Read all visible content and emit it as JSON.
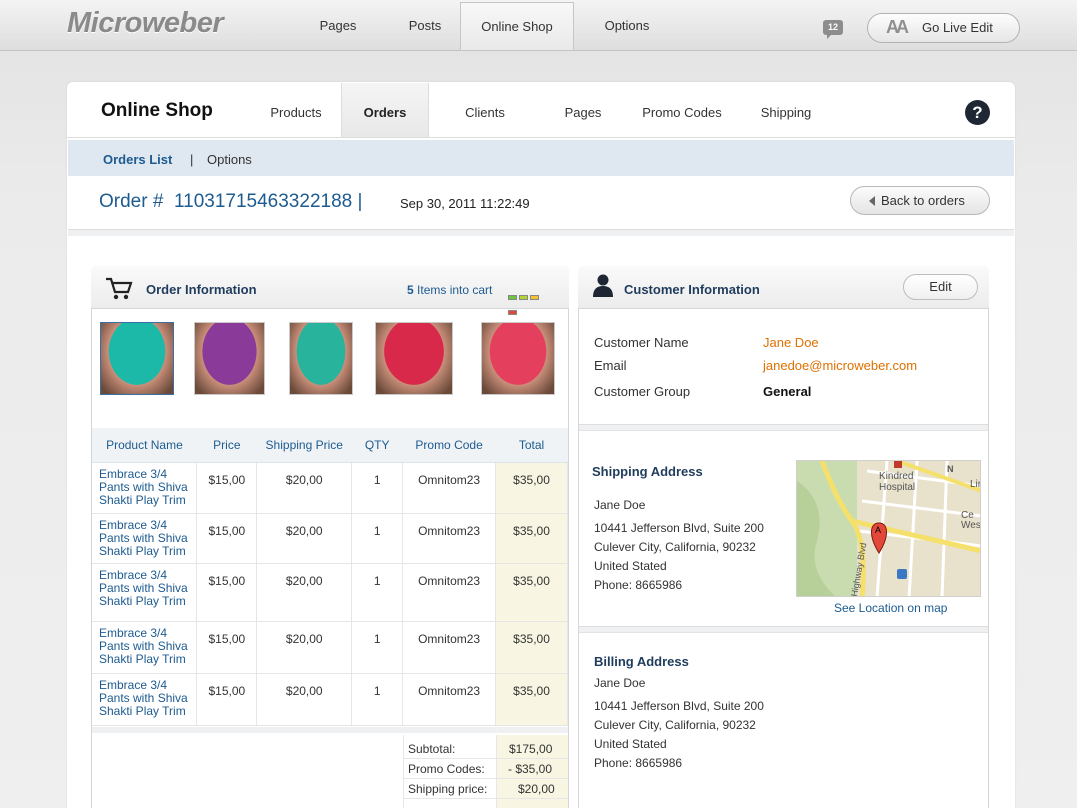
{
  "topbar": {
    "logo": "Microweber",
    "nav": [
      "Pages",
      "Posts",
      "Online Shop",
      "Options"
    ],
    "active_nav": "Online Shop",
    "notifications": "12",
    "golive_label": "Go Live Edit"
  },
  "shop": {
    "title": "Online Shop",
    "tabs": [
      "Products",
      "Orders",
      "Clients",
      "Pages",
      "Promo Codes",
      "Shipping"
    ],
    "active_tab": "Orders",
    "help": "?",
    "subtabs": {
      "orders_list": "Orders List",
      "separator": "|",
      "options": "Options"
    }
  },
  "order": {
    "number_label": "Order #",
    "number": "11031715463322188",
    "separator": "|",
    "date": "Sep 30, 2011 11:22:49",
    "back_label": "Back to orders"
  },
  "order_info": {
    "title": "Order Information",
    "cart_count": "5",
    "cart_text": "Items into cart",
    "status_colors": [
      "#6cc644",
      "#b5d334",
      "#f2c230",
      "#e2473a"
    ],
    "thumb_colors": [
      "#1cb9a8",
      "#8a3a99",
      "#27b39c",
      "#d8294a",
      "#e4405d"
    ],
    "columns": [
      "Product Name",
      "Price",
      "Shipping Price",
      "QTY",
      "Promo Code",
      "Total"
    ],
    "rows": [
      {
        "name": "Embrace 3/4 Pants with Shiva Shakti Play Trim",
        "price": "$15,00",
        "shipping": "$20,00",
        "qty": "1",
        "promo": "Omnitom23",
        "total": "$35,00"
      },
      {
        "name": "Embrace 3/4 Pants with Shiva Shakti Play Trim",
        "price": "$15,00",
        "shipping": "$20,00",
        "qty": "1",
        "promo": "Omnitom23",
        "total": "$35,00"
      },
      {
        "name": "Embrace 3/4 Pants with Shiva Shakti Play Trim",
        "price": "$15,00",
        "shipping": "$20,00",
        "qty": "1",
        "promo": "Omnitom23",
        "total": "$35,00"
      },
      {
        "name": "Embrace 3/4 Pants with Shiva Shakti Play Trim",
        "price": "$15,00",
        "shipping": "$20,00",
        "qty": "1",
        "promo": "Omnitom23",
        "total": "$35,00"
      },
      {
        "name": "Embrace 3/4 Pants with Shiva Shakti Play Trim",
        "price": "$15,00",
        "shipping": "$20,00",
        "qty": "1",
        "promo": "Omnitom23",
        "total": "$35,00"
      }
    ],
    "summary": [
      {
        "label": "Subtotal:",
        "value": "$175,00"
      },
      {
        "label": "Promo Codes:",
        "value": "- $35,00"
      },
      {
        "label": "Shipping price:",
        "value": "$20,00"
      }
    ]
  },
  "customer": {
    "title": "Customer Information",
    "edit_label": "Edit",
    "fields": [
      {
        "label": "Customer Name",
        "value": "Jane Doe"
      },
      {
        "label": "Email",
        "value": "janedoe@microweber.com"
      },
      {
        "label": "Customer Group",
        "value": "General"
      }
    ],
    "shipping": {
      "title": "Shipping Address",
      "lines": [
        "Jane Doe",
        "10441 Jefferson Blvd, Suite 200",
        "Culever City, California, 90232",
        "United Stated",
        "Phone: 8665986"
      ],
      "map_link": "See Location on map",
      "map_labels": [
        "Kindred",
        "Hospital",
        "Highway Blvd",
        "Ce",
        "Wes",
        "Lir",
        "A"
      ]
    },
    "billing": {
      "title": "Billing Address",
      "lines": [
        "Jane Doe",
        "10441 Jefferson Blvd, Suite 200",
        "Culever City, California, 90232",
        "United Stated",
        "Phone: 8665986"
      ]
    }
  }
}
